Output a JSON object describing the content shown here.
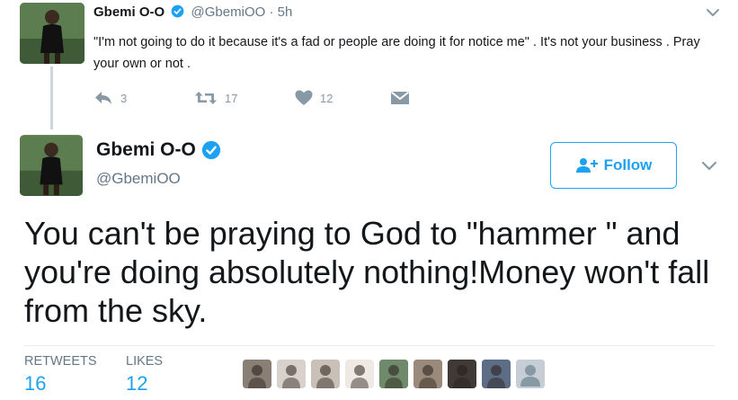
{
  "reply_tweet": {
    "author_name": "Gbemi O-O",
    "handle": "@GbemiOO",
    "separator": "·",
    "time": "5h",
    "text": "\"I'm not going to do it because it's a fad or people are doing it for notice me\" . It's not your business . Pray your own or not .",
    "actions": {
      "reply_count": "3",
      "retweet_count": "17",
      "like_count": "12"
    }
  },
  "main_tweet": {
    "author_name": "Gbemi O-O",
    "handle": "@GbemiOO",
    "follow_label": "Follow",
    "text": "You can't be praying to God to \"hammer \" and you're doing absolutely nothing!Money won't fall from the sky.",
    "stats": {
      "retweets_label": "RETWEETS",
      "retweets_value": "16",
      "likes_label": "LIKES",
      "likes_value": "12"
    }
  },
  "colors": {
    "accent": "#1da1f2",
    "muted": "#657786",
    "action_gray": "#8899a6",
    "text": "#14171a"
  },
  "likers": [
    {
      "name": "liker-avatar-1",
      "color": "#8a7f74"
    },
    {
      "name": "liker-avatar-2",
      "color": "#d9d2cc"
    },
    {
      "name": "liker-avatar-3",
      "color": "#c9c1b7"
    },
    {
      "name": "liker-avatar-4",
      "color": "#efe9e4"
    },
    {
      "name": "liker-avatar-5",
      "color": "#6f8a6a"
    },
    {
      "name": "liker-avatar-6",
      "color": "#9a8a7c"
    },
    {
      "name": "liker-avatar-7",
      "color": "#3f3a36"
    },
    {
      "name": "liker-avatar-8",
      "color": "#5e6d86"
    },
    {
      "name": "liker-avatar-9",
      "color": "#c6cdd4"
    }
  ]
}
